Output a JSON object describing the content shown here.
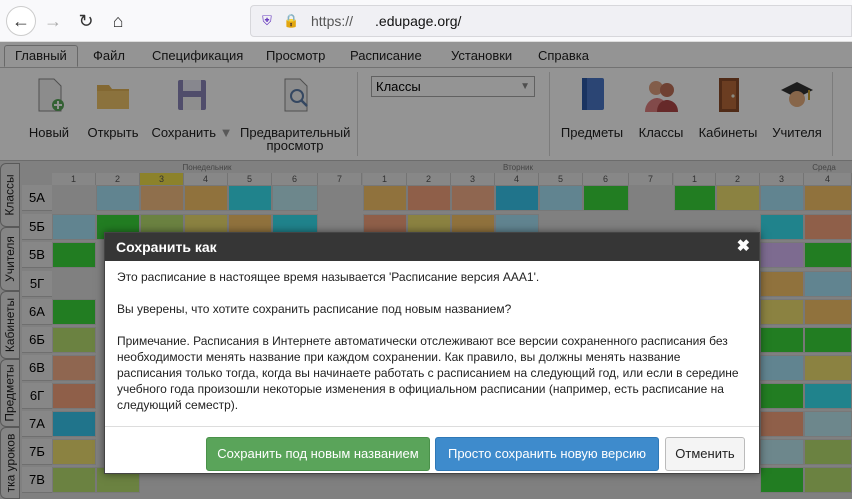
{
  "browser": {
    "url_prefix": "https://",
    "url_domain": ".edupage.org/"
  },
  "menu": {
    "tabs": [
      "Главный",
      "Файл",
      "Спецификация",
      "Просмотр",
      "Расписание",
      "Установки",
      "Справка"
    ]
  },
  "ribbon": {
    "new": "Новый",
    "open": "Открыть",
    "save": "Сохранить",
    "preview_line1": "Предварительный",
    "preview_line2": "просмотр",
    "class_select": "Классы",
    "subjects": "Предметы",
    "classes": "Классы",
    "rooms": "Кабинеты",
    "teachers": "Учителя"
  },
  "side_tabs": [
    "Классы",
    "Учителя",
    "Кабинеты",
    "Предметы",
    "тка уроков"
  ],
  "timetable": {
    "days": [
      "Понедельник",
      "Вторник",
      "Среда"
    ],
    "periods": [
      "1",
      "2",
      "3",
      "4",
      "5",
      "6",
      "7"
    ],
    "rows": [
      "5А",
      "5Б",
      "5В",
      "5Г",
      "6А",
      "6Б",
      "6В",
      "6Г",
      "7А",
      "7Б",
      "7В"
    ]
  },
  "dialog": {
    "title": "Сохранить как",
    "close": "✖",
    "para1": "Это расписание в настоящее время называется 'Расписание версия AAA1'.",
    "para2": "Вы уверены, что хотите сохранить расписание под новым названием?",
    "para3": "Примечание. Расписания в Интернете автоматически отслеживают все версии сохраненного расписания без необходимости менять название при каждом сохранении. Как правило, вы должны менять название расписания только тогда, когда вы начинаете работать с расписанием на следующий год, или если в середине учебного года произошли некоторые изменения в официальном расписании (например, есть расписание на следующий семестр).",
    "btn_save_new": "Сохранить под новым названием",
    "btn_save_version": "Просто сохранить новую версию",
    "btn_cancel": "Отменить"
  }
}
